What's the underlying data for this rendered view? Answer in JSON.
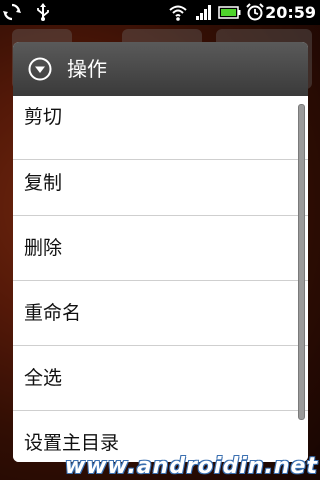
{
  "status_bar": {
    "time": "20:59",
    "icons": [
      "sync-icon",
      "usb-icon",
      "wifi-icon",
      "signal-icon",
      "battery-icon",
      "alarm-icon"
    ],
    "battery_color": "#4fd42c"
  },
  "dialog": {
    "title": "操作",
    "title_icon": "circle-chevron-down-icon",
    "items": [
      {
        "label": "剪切"
      },
      {
        "label": "复制"
      },
      {
        "label": "删除"
      },
      {
        "label": "重命名"
      },
      {
        "label": "全选"
      },
      {
        "label": "设置主目录"
      }
    ]
  },
  "watermark": "www.androidin.net"
}
